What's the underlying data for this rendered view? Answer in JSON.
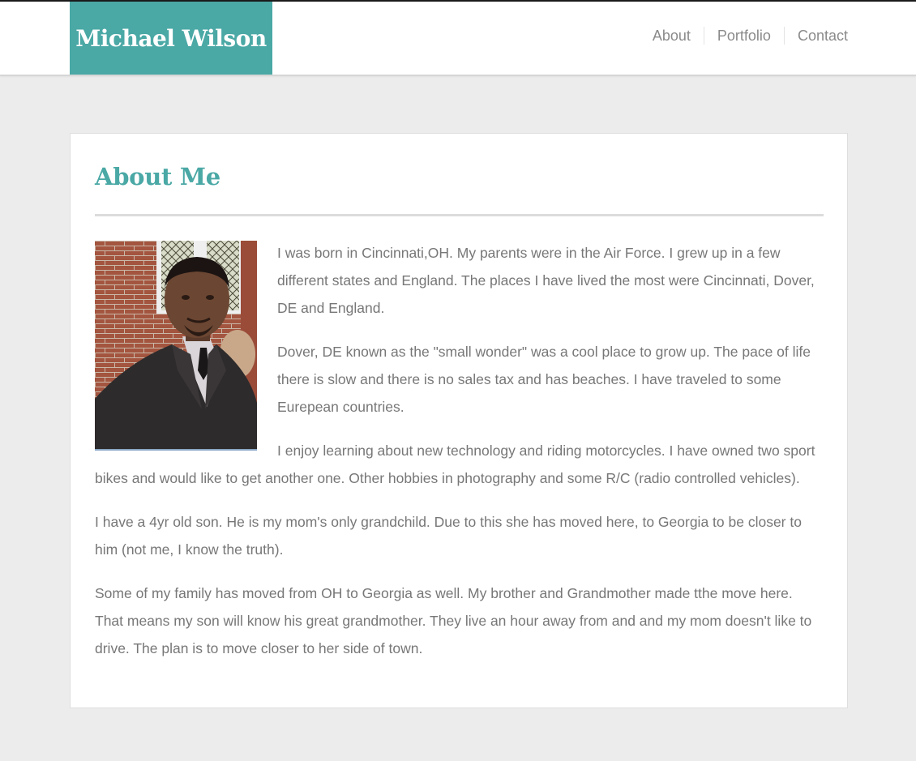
{
  "header": {
    "site_name": "Michael Wilson",
    "brand_color": "#4aa8a5",
    "nav": [
      {
        "label": "About"
      },
      {
        "label": "Portfolio"
      },
      {
        "label": "Contact"
      }
    ]
  },
  "main": {
    "title": "About Me",
    "photo_icon": "portrait-photo",
    "paragraphs": [
      "I was born in Cincinnati,OH. My parents were in the Air Force. I grew up in a few different states and England. The places I have lived the most were Cincinnati, Dover, DE and England.",
      "Dover, DE known as the \"small wonder\" was a cool place to grow up. The pace of life there is slow and there is no sales tax and has beaches. I have traveled to some Eurepean countries.",
      "I enjoy learning about new technology and riding motorcycles. I have owned two sport bikes and would like to get another one. Other hobbies in photography and some R/C (radio controlled vehicles).",
      "I have a 4yr old son. He is my mom's only grandchild. Due to this she has moved here, to Georgia to be closer to him (not me, I know the truth).",
      "Some of my family has moved from OH to Georgia as well. My brother and Grandmother made tthe move here. That means my son will know his great grandmother. They live an hour away from and and my mom doesn't like to drive. The plan is to move closer to her side of town."
    ]
  }
}
